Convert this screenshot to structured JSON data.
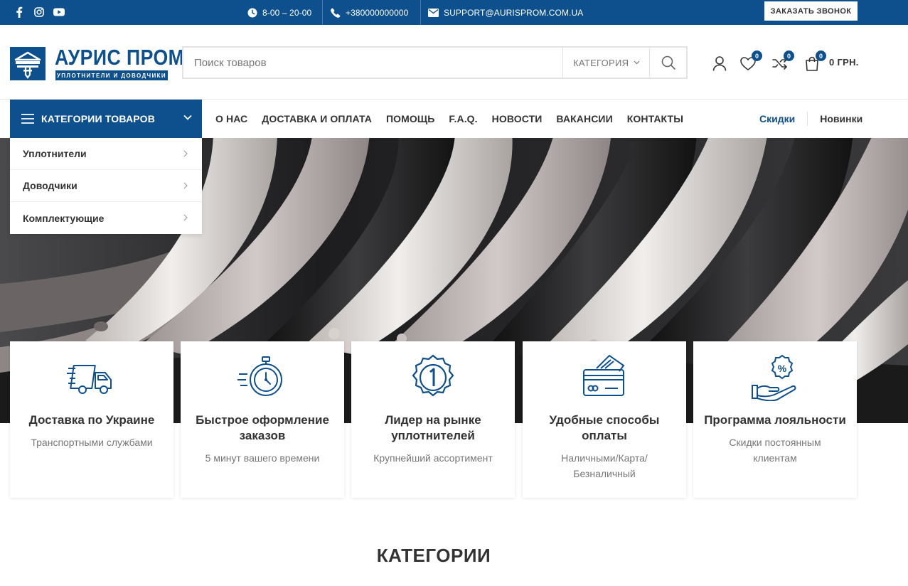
{
  "topbar": {
    "hours": "8-00 – 20-00",
    "phone": "+380000000000",
    "email": "SUPPORT@AURISPROM.COM.UA",
    "callback_label": "ЗАКАЗАТЬ ЗВОНОК"
  },
  "logo": {
    "name": "АУРИС ПРОМ",
    "tagline": "УПЛОТНИТЕЛИ И ДОВОДЧИКИ"
  },
  "search": {
    "placeholder": "Поиск товаров",
    "category_label": "КАТЕГОРИЯ"
  },
  "header": {
    "wishlist_count": "0",
    "compare_count": "0",
    "cart_count": "0",
    "cart_total": "0 ГРН."
  },
  "nav": {
    "categories_label": "КАТЕГОРИИ ТОВАРОВ",
    "menu": [
      "О НАС",
      "ДОСТАВКА И ОПЛАТА",
      "ПОМОЩЬ",
      "F.A.Q.",
      "НОВОСТИ",
      "ВАКАНСИИ",
      "КОНТАКТЫ"
    ],
    "discounts": "Скидки",
    "new": "Новинки"
  },
  "dropdown": {
    "items": [
      "Уплотнители",
      "Доводчики",
      "Комплектующие"
    ]
  },
  "features": [
    {
      "icon": "delivery-truck-icon",
      "title": "Доставка по Украине",
      "desc": "Транспортными службами"
    },
    {
      "icon": "stopwatch-icon",
      "title": "Быстрое оформление заказов",
      "desc": "5 минут вашего времени"
    },
    {
      "icon": "medal-number-one-icon",
      "title": "Лидер на рынке уплотнителей",
      "desc": "Крупнейший ассортимент"
    },
    {
      "icon": "credit-card-icon",
      "title": "Удобные способы оплаты",
      "desc": "Наличными/Карта/ Безналичный"
    },
    {
      "icon": "loyalty-percent-icon",
      "title": "Программа лояльности",
      "desc": "Скидки постоянным клиентам"
    }
  ],
  "sections": {
    "categories_title": "КАТЕГОРИИ"
  },
  "colors": {
    "brand": "#0e4f8d",
    "text": "#333333",
    "muted": "#777777"
  }
}
